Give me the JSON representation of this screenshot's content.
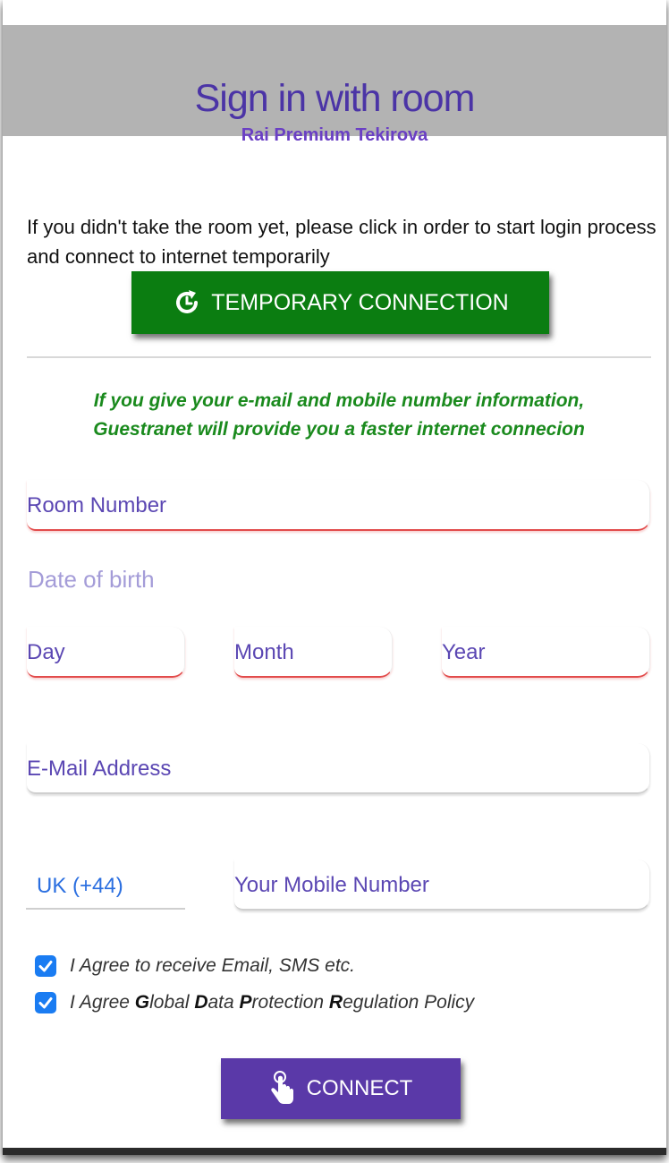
{
  "header": {
    "title": "Sign in with room",
    "subtitle": "Rai Premium Tekirova"
  },
  "intro": {
    "text": "If you didn't take the room yet, please click in order to start login process and connect to internet temporarily"
  },
  "temporary_connection": {
    "label": "TEMPORARY CONNECTION",
    "icon": "refresh-clock-icon"
  },
  "notice": {
    "line1": "If you give your e-mail and mobile number information,",
    "line2": "Guestranet will provide you a faster internet connecion"
  },
  "form": {
    "room_number_placeholder": "Room Number",
    "date_of_birth_label": "Date of birth",
    "day_placeholder": "Day",
    "month_placeholder": "Month",
    "year_placeholder": "Year",
    "email_placeholder": "E-Mail Address",
    "country_code_value": "UK (+44)",
    "mobile_placeholder": "Your Mobile Number"
  },
  "consents": [
    {
      "checked": true,
      "text": "I Agree to receive Email, SMS etc."
    },
    {
      "checked": true,
      "parts": [
        {
          "t": "I Agree ",
          "b": false
        },
        {
          "t": "G",
          "b": true
        },
        {
          "t": "lobal ",
          "b": false
        },
        {
          "t": "D",
          "b": true
        },
        {
          "t": "ata ",
          "b": false
        },
        {
          "t": "P",
          "b": true
        },
        {
          "t": "rotection ",
          "b": false
        },
        {
          "t": "R",
          "b": true
        },
        {
          "t": "egulation Policy",
          "b": false
        }
      ]
    }
  ],
  "connect": {
    "label": "CONNECT",
    "icon": "hand-pointer-icon"
  },
  "colors": {
    "header_bg": "#b3b3b3",
    "title": "#4b34a6",
    "temp_button": "#0b7d11",
    "notice": "#1a8a1d",
    "connect_button": "#5a39a8",
    "checkbox": "#1a7cf2",
    "required_underline": "#e24b4b"
  }
}
